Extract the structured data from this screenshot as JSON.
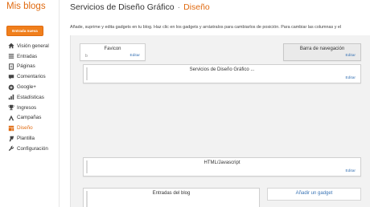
{
  "app": {
    "brand": "Mis blogs"
  },
  "header": {
    "blog_name": "Servicios de Diseño Gráfico",
    "separator": "·",
    "section": "Diseño"
  },
  "sidebar": {
    "new_post_label": "Entrada nueva",
    "items": [
      {
        "label": "Visión general",
        "icon": "home-icon"
      },
      {
        "label": "Entradas",
        "icon": "posts-icon"
      },
      {
        "label": "Páginas",
        "icon": "pages-icon"
      },
      {
        "label": "Comentarios",
        "icon": "comments-icon"
      },
      {
        "label": "Google+",
        "icon": "google-plus-icon"
      },
      {
        "label": "Estadísticas",
        "icon": "stats-icon"
      },
      {
        "label": "Ingresos",
        "icon": "trophy-icon"
      },
      {
        "label": "Campañas",
        "icon": "campaigns-icon"
      },
      {
        "label": "Diseño",
        "icon": "layout-icon",
        "active": true
      },
      {
        "label": "Plantilla",
        "icon": "template-icon"
      },
      {
        "label": "Configuración",
        "icon": "wrench-icon"
      }
    ]
  },
  "layout": {
    "instructions": "Añade, suprime y edita gadgets en tu blog. Haz clic en los gadgets y arrástralos para cambiarlos de posición. Para cambiar las columnas y el",
    "edit_label": "Editar",
    "gadgets": {
      "favicon": "Favicon",
      "navbar": "Barra de navegación",
      "header": "Servicios de Diseño Gráfico ...",
      "html": "HTML/Javascript",
      "posts": "Entradas del blog"
    },
    "add_gadget_label": "Añadir un gadget"
  },
  "colors": {
    "accent": "#e06a10",
    "button": "#f07f1c",
    "link": "#3a74b5"
  }
}
